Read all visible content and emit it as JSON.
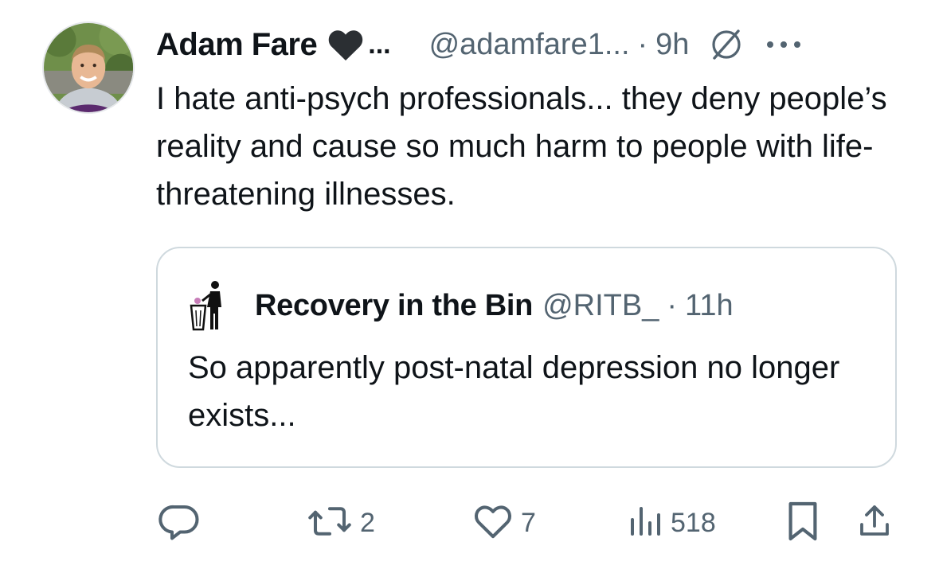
{
  "tweet": {
    "author_name": "Adam Fare",
    "name_ellipsis": "...",
    "handle": "@adamfare1...",
    "separator": "·",
    "time": "9h",
    "text": "I hate anti-psych professionals... they deny people’s reality and cause so much harm to people with life-threatening illnesses."
  },
  "quote": {
    "author_name": "Recovery in the Bin",
    "handle": "@RITB_",
    "separator": "·",
    "time": "11h",
    "text": "So apparently post-natal depression no longer exists..."
  },
  "actions": {
    "replies": "",
    "reposts": "2",
    "likes": "7",
    "views": "518"
  },
  "icons": {
    "reply": "reply-icon",
    "repost": "repost-icon",
    "like": "heart-icon",
    "views": "views-icon",
    "bookmark": "bookmark-icon",
    "share": "share-icon",
    "more": "more-icon",
    "badge": "black-heart-icon",
    "ring": "circle-slash-icon"
  },
  "colors": {
    "text": "#0f1419",
    "secondary": "#536471",
    "border": "#cfd9de"
  }
}
